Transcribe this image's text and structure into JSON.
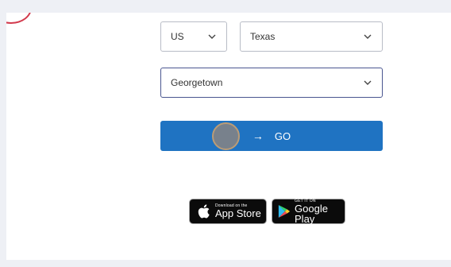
{
  "location": {
    "country": {
      "value": "US"
    },
    "state": {
      "value": "Texas"
    },
    "city": {
      "value": "Georgetown"
    }
  },
  "go_button": {
    "label": "GO",
    "icon": "arrow-right-icon"
  },
  "app_store": {
    "small": "Download on the",
    "big": "App Store",
    "icon": "apple-icon"
  },
  "google_play": {
    "small": "GET IT ON",
    "big": "Google Play",
    "icon": "google-play-icon"
  },
  "colors": {
    "accent": "#1f73c2",
    "focus_border": "#4a5690",
    "step_badge": "#d23a4d",
    "background": "#eef0f5"
  }
}
